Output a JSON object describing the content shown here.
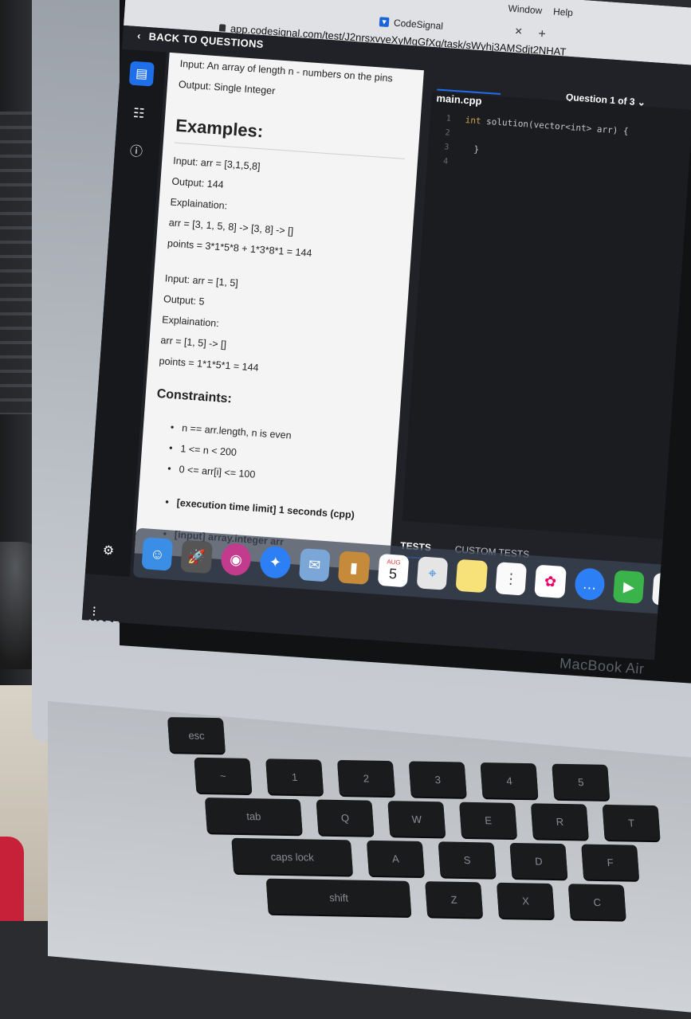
{
  "browser": {
    "menu": [
      "Window",
      "Help"
    ],
    "tab_title": "CodeSignal",
    "url": "app.codesignal.com/test/J2nrsxvyeXyMgGfXq/task/sWyhj3AMSdjt2NHAT"
  },
  "header": {
    "back_label": "BACK TO QUESTIONS",
    "question_counter": "Question 1 of 3"
  },
  "sidebar": {
    "more_label": "MORE"
  },
  "problem": {
    "input_desc": "Input: An array of length n - numbers on the pins",
    "output_desc": "Output: Single Integer",
    "examples_heading": "Examples:",
    "examples": [
      {
        "input": "Input: arr = [3,1,5,8]",
        "output": "Output: 144",
        "explanation_label": "Explaination:",
        "step": "arr = [3, 1, 5, 8] -> [3, 8] -> []",
        "points": "points = 3*1*5*8 + 1*3*8*1 = 144"
      },
      {
        "input": "Input: arr = [1, 5]",
        "output": "Output: 5",
        "explanation_label": "Explaination:",
        "step": "arr = [1, 5] -> []",
        "points": "points = 1*1*5*1 = 144"
      }
    ],
    "constraints_heading": "Constraints:",
    "constraints": [
      "n == arr.length, n is even",
      "1 <= n < 200",
      "0 <= arr[i] <= 100"
    ],
    "execution_limit": "[execution time limit] 1 seconds (cpp)",
    "input_type": "[input] array.integer arr"
  },
  "editor": {
    "file_name": "main.cpp",
    "line_numbers": [
      "1",
      "2",
      "3",
      "4"
    ],
    "code_line_1_kw": "int",
    "code_line_1_rest": " solution(vector<int> arr) {",
    "code_line_3": "}"
  },
  "tests_tabs": {
    "tests_label": "TESTS",
    "custom_tests_label": "CUSTOM TESTS"
  },
  "dock": {
    "calendar_month": "AUG",
    "calendar_day": "5"
  },
  "laptop": {
    "brand": "MacBook Air"
  },
  "keyboard": {
    "keys": [
      "esc",
      "~",
      "1",
      "2",
      "3",
      "4",
      "5",
      "tab",
      "Q",
      "W",
      "E",
      "R",
      "T",
      "caps lock",
      "A",
      "S",
      "D",
      "F",
      "shift",
      "Z",
      "X",
      "C"
    ]
  },
  "colors": {
    "accent": "#1f6feb",
    "panel_bg": "#f4f4f4",
    "app_bg": "#202227"
  }
}
